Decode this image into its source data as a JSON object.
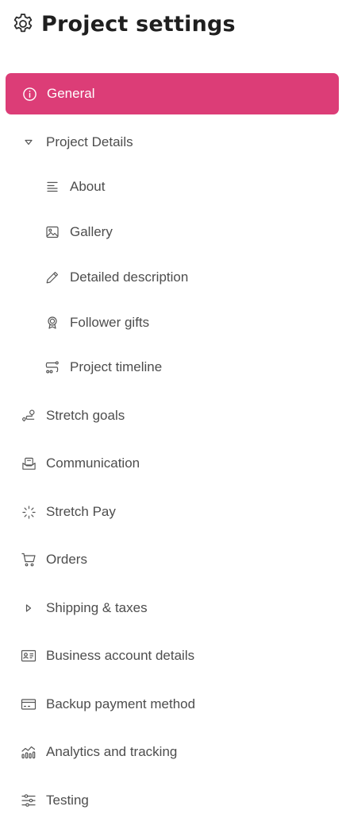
{
  "header": {
    "title": "Project settings",
    "icon": "gear-icon"
  },
  "theme": {
    "accent": "#dc3d77",
    "text": "#4d4d4d",
    "title": "#1f1f1f"
  },
  "nav": {
    "general": {
      "label": "General",
      "icon": "info-icon",
      "active": true
    },
    "project_details": {
      "label": "Project Details",
      "icon": "caret-down-icon",
      "expanded": true
    },
    "about": {
      "label": "About",
      "icon": "text-lines-icon"
    },
    "gallery": {
      "label": "Gallery",
      "icon": "image-icon"
    },
    "detailed_description": {
      "label": "Detailed description",
      "icon": "pencil-icon"
    },
    "follower_gifts": {
      "label": "Follower gifts",
      "icon": "award-icon"
    },
    "project_timeline": {
      "label": "Project timeline",
      "icon": "timeline-icon"
    },
    "stretch_goals": {
      "label": "Stretch goals",
      "icon": "route-icon"
    },
    "communication": {
      "label": "Communication",
      "icon": "inbox-icon"
    },
    "stretch_pay": {
      "label": "Stretch Pay",
      "icon": "loader-icon"
    },
    "orders": {
      "label": "Orders",
      "icon": "cart-icon"
    },
    "shipping_taxes": {
      "label": "Shipping & taxes",
      "icon": "caret-right-icon",
      "expanded": false
    },
    "business_account": {
      "label": "Business account details",
      "icon": "id-card-icon"
    },
    "backup_payment": {
      "label": "Backup payment method",
      "icon": "credit-card-icon"
    },
    "analytics": {
      "label": "Analytics and tracking",
      "icon": "chart-icon"
    },
    "testing": {
      "label": "Testing",
      "icon": "sliders-icon"
    }
  }
}
